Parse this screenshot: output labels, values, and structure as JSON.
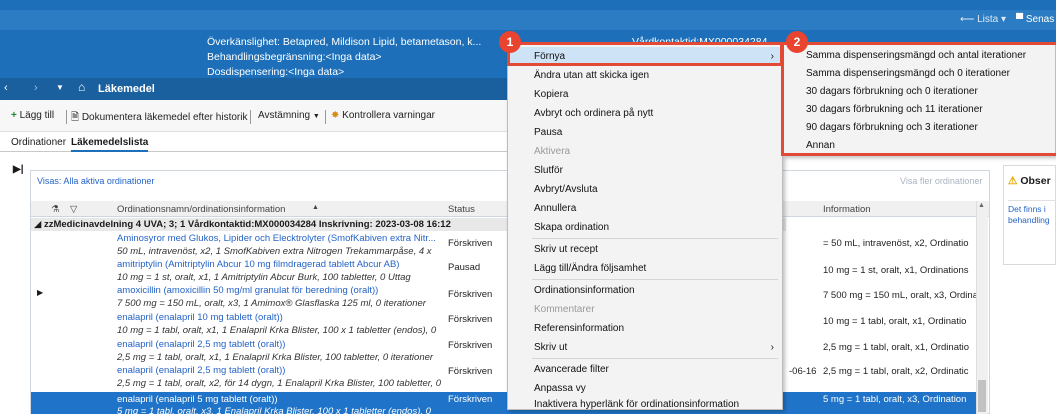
{
  "banner": {
    "allergy": "Överkänslighet: Betapred, Mildison Lipid, betametason, k...",
    "limitation": "Behandlingsbegränsning:<Inga data>",
    "dose_dispensing": "Dosdispensering:<Inga data>",
    "contact_id": "Vårdkontaktid:MX000034284",
    "list_link": "Lista",
    "recent_link": "Senas"
  },
  "nav": {
    "title": "Läkemedel"
  },
  "toolbar": {
    "add": "Lägg till",
    "document": "Dokumentera läkemedel efter historik",
    "reconcile": "Avstämning",
    "check_warnings": "Kontrollera varningar"
  },
  "tabs": [
    {
      "label": "Ordinationer"
    },
    {
      "label": "Läkemedelslista"
    }
  ],
  "list": {
    "filter_text": "Visas: Alla aktiva ordinationer",
    "show_more": "Visa fler ordinationer",
    "columns": {
      "name": "Ordinationsnamn/ordinationsinformation",
      "status": "Status",
      "information": "Information"
    },
    "group_header": "zzMedicinavdelning 4 UVA; 3; 1  Vårdkontaktid:MX000034284  Inskrivning: 2023-03-08 16:12",
    "rows": [
      {
        "name": "Aminosyror med Glukos, Lipider och Elecktrolyter (SmofKabiven extra Nitr...",
        "detail": "50 mL, intravenöst, x2, 1 SmofKabiven extra Nitrogen Trekammarpåse, 4 x",
        "status": "Förskriven",
        "info": "= 50 mL, intravenöst, x2, Ordinatio"
      },
      {
        "name": "amitriptylin (Amitriptylin Abcur 10 mg filmdragerad tablett Abcur AB)",
        "detail": "10 mg = 1 st, oralt, x1, 1 Amitriptylin Abcur Burk, 100 tabletter, 0 Uttag",
        "status": "Pausad",
        "info": "10 mg = 1 st, oralt, x1, Ordinations"
      },
      {
        "name": "amoxicillin (amoxicillin 50 mg/ml granulat för beredning (oralt))",
        "detail": "7 500 mg = 150 mL, oralt, x3, 1 Amimox® Glasflaska 125 ml, 0 iterationer",
        "status": "Förskriven",
        "info": "7 500 mg = 150 mL, oralt, x3, Ordinatio"
      },
      {
        "name": "enalapril (enalapril 10 mg tablett (oralt))",
        "detail": "10 mg = 1 tabl, oralt, x1, 1 Enalapril Krka Blister, 100 x 1 tabletter (endos), 0",
        "status": "Förskriven",
        "info": "10 mg = 1 tabl, oralt, x1, Ordinatio"
      },
      {
        "name": "enalapril (enalapril 2,5 mg tablett (oralt))",
        "detail": "2,5 mg = 1 tabl, oralt, x1, 1 Enalapril Krka Blister, 100 tabletter, 0 iterationer",
        "status": "Förskriven",
        "info": "2,5 mg = 1 tabl, oralt, x1, Ordinatio"
      },
      {
        "name": "enalapril (enalapril 2,5 mg tablett (oralt))",
        "detail": "2,5 mg = 1 tabl, oralt, x2, för 14 dygn, 1 Enalapril Krka Blister, 100 tabletter, 0",
        "status": "Förskriven",
        "date": "-06-16",
        "info": "2,5 mg = 1 tabl, oralt, x2, Ordinatic"
      },
      {
        "name": "enalapril (enalapril 5 mg tablett (oralt))",
        "detail": "5 mg = 1 tabl, oralt, x3, 1 Enalapril Krka Blister, 100 x 1 tabletter (endos), 0",
        "status": "Förskriven",
        "info": "5 mg = 1 tabl, oralt, x3, Ordination"
      }
    ]
  },
  "context_menu": [
    {
      "label": "Förnya",
      "state": "highlighted",
      "submenu": true
    },
    {
      "label": "Ändra utan att skicka igen",
      "state": "normal"
    },
    {
      "label": "Kopiera",
      "state": "normal"
    },
    {
      "label": "Avbryt och ordinera på nytt",
      "state": "normal"
    },
    {
      "label": "Pausa",
      "state": "normal"
    },
    {
      "label": "Aktivera",
      "state": "disabled"
    },
    {
      "label": "Slutför",
      "state": "normal"
    },
    {
      "label": "Avbryt/Avsluta",
      "state": "normal"
    },
    {
      "label": "Annullera",
      "state": "normal"
    },
    {
      "label": "Skapa ordination",
      "state": "normal"
    },
    {
      "label": "Skriv ut recept",
      "state": "normal"
    },
    {
      "label": "Lägg till/Ändra följsamhet",
      "state": "normal"
    },
    {
      "label": "Ordinationsinformation",
      "state": "normal"
    },
    {
      "label": "Kommentarer",
      "state": "disabled"
    },
    {
      "label": "Referensinformation",
      "state": "normal"
    },
    {
      "label": "Skriv ut",
      "state": "normal",
      "submenu": true
    },
    {
      "label": "Avancerade filter",
      "state": "normal"
    },
    {
      "label": "Anpassa vy",
      "state": "normal"
    },
    {
      "label": "Inaktivera hyperlänk för ordinationsinformation",
      "state": "normal"
    }
  ],
  "submenu": [
    "Samma dispenseringsmängd och antal iterationer",
    "Samma dispenseringsmängd och 0 iterationer",
    "30 dagars förbrukning och 0 iterationer",
    "30 dagars förbrukning och 11 iterationer",
    "90 dagars förbrukning och 3 iterationer",
    "Annan"
  ],
  "badges": [
    "1",
    "2"
  ],
  "side_panel": {
    "title": "Obser",
    "text_line1": "Det finns i",
    "text_line2": "behandling"
  },
  "colors": {
    "banner": "#1c6fb8",
    "highlight_box": "#e24a35",
    "link": "#2563c7",
    "selected_row": "#1f74c9"
  }
}
